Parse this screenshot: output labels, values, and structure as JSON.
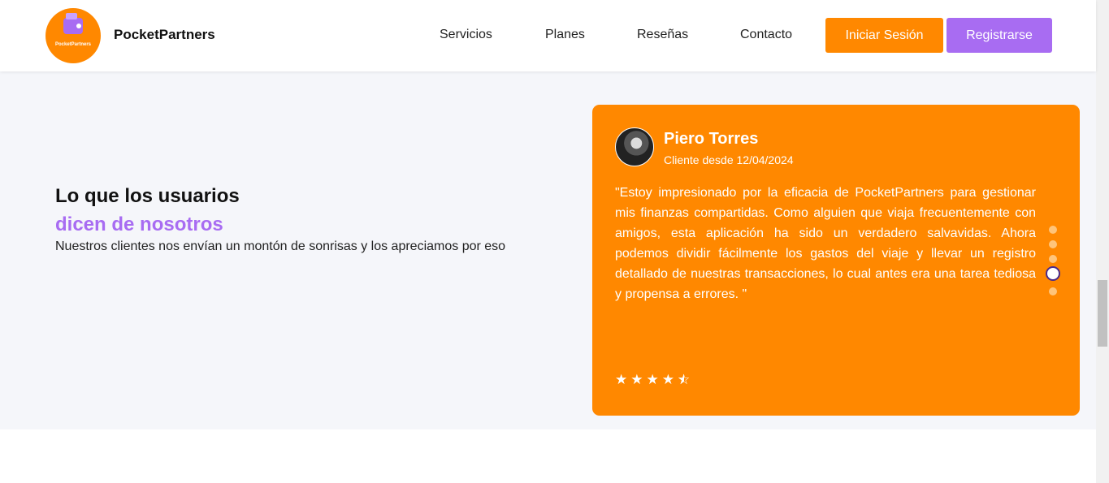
{
  "header": {
    "logo_text": "PocketPartners",
    "brand": "PocketPartners",
    "nav": [
      "Servicios",
      "Planes",
      "Reseñas",
      "Contacto"
    ],
    "login_label": "Iniciar Sesión",
    "register_label": "Registrarse"
  },
  "testimonials": {
    "title_line1": "Lo que los usuarios",
    "title_line2": "dicen de nosotros",
    "subtitle": "Nuestros clientes nos envían un montón de sonrisas y los apreciamos por eso",
    "review": {
      "name": "Piero Torres",
      "since": "Cliente desde 12/04/2024",
      "text": "\"Estoy impresionado por la eficacia de PocketPartners para gestionar mis finanzas compartidas. Como alguien que viaja frecuentemente con amigos, esta aplicación ha sido un verdadero salvavidas. Ahora podemos dividir fácilmente los gastos del viaje y llevar un registro detallado de nuestras transacciones, lo cual antes era una tarea tediosa y propensa a errores. \"",
      "rating": 4.5,
      "max_rating": 5
    },
    "carousel": {
      "slide_count": 5,
      "active_index": 3
    }
  },
  "colors": {
    "accent_orange": "#ff8800",
    "accent_purple": "#a86cf2",
    "section_bg": "#f5f6fa"
  }
}
